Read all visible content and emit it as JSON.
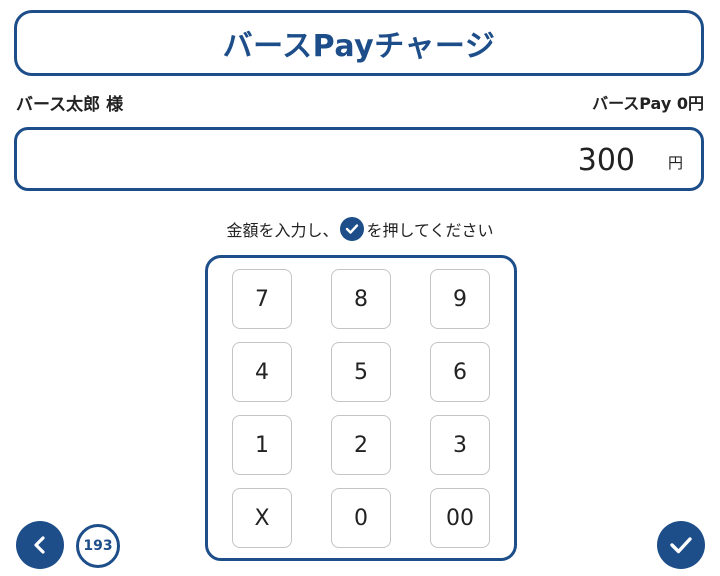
{
  "header": {
    "title": "バースPayチャージ"
  },
  "account": {
    "user_name": "バース太郎 様",
    "balance": "バースPay 0円"
  },
  "amount": {
    "value": "300",
    "unit": "円"
  },
  "instruction": {
    "before": "金額を入力し、",
    "after": "を押してください"
  },
  "keypad": {
    "keys": [
      "7",
      "8",
      "9",
      "4",
      "5",
      "6",
      "1",
      "2",
      "3",
      "X",
      "0",
      "00"
    ]
  },
  "footer": {
    "counter": "193"
  },
  "colors": {
    "accent": "#1d4e89",
    "key_border": "#c4c4c4"
  },
  "icons": {
    "back": "chevron-left-icon",
    "confirm": "check-icon",
    "inline": "check-icon"
  }
}
